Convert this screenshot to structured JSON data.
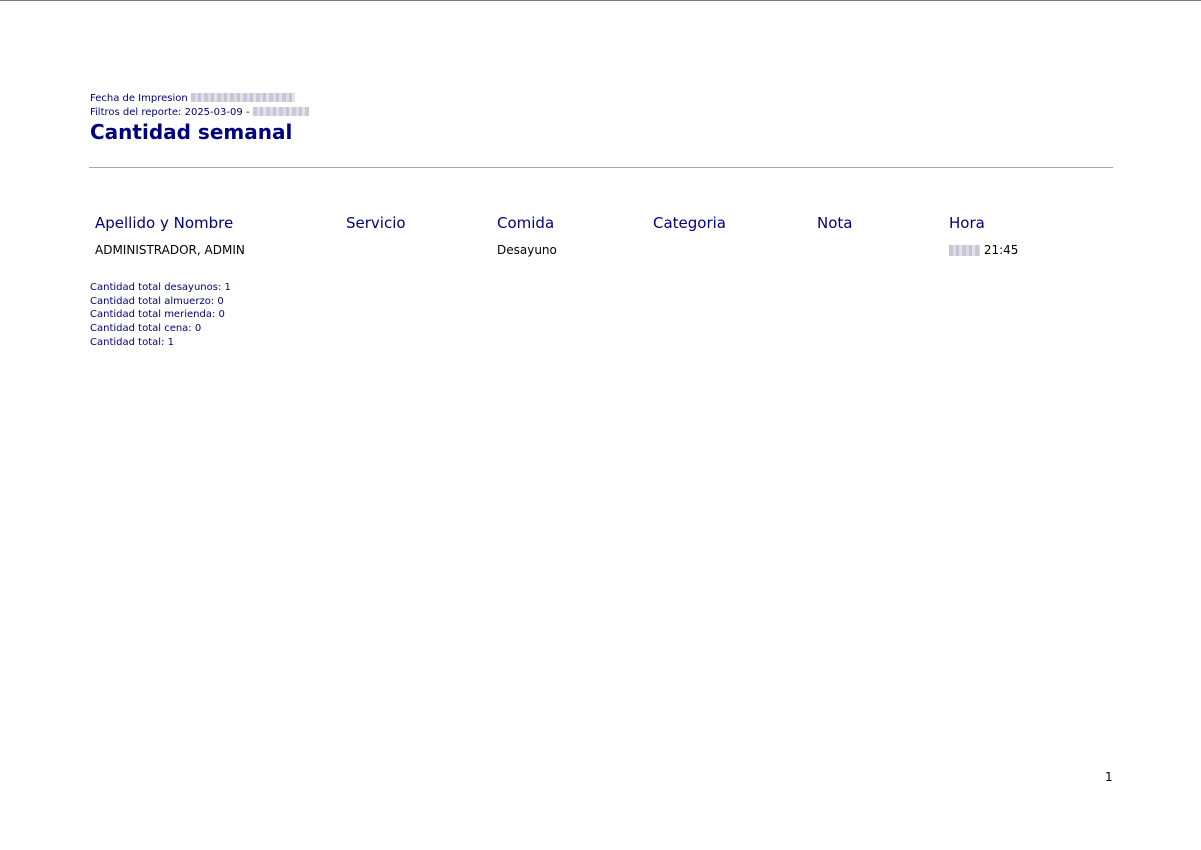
{
  "report": {
    "print_date_label": "Fecha de Impresion",
    "filters_label": "Filtros del reporte: 2025-03-09 -",
    "title": "Cantidad semanal"
  },
  "table": {
    "headers": [
      "Apellido y Nombre",
      "Servicio",
      "Comida",
      "Categoria",
      "Nota",
      "Hora"
    ],
    "rows": [
      {
        "nombre": "ADMINISTRADOR, ADMIN",
        "servicio": "",
        "comida": "Desayuno",
        "categoria": "",
        "nota": "",
        "hora": "21:45"
      }
    ]
  },
  "totals": [
    "Cantidad total desayunos: 1",
    "Cantidad total almuerzo: 0",
    "Cantidad total merienda: 0",
    "Cantidad total cena: 0",
    "Cantidad total: 1"
  ],
  "page_number": "1"
}
